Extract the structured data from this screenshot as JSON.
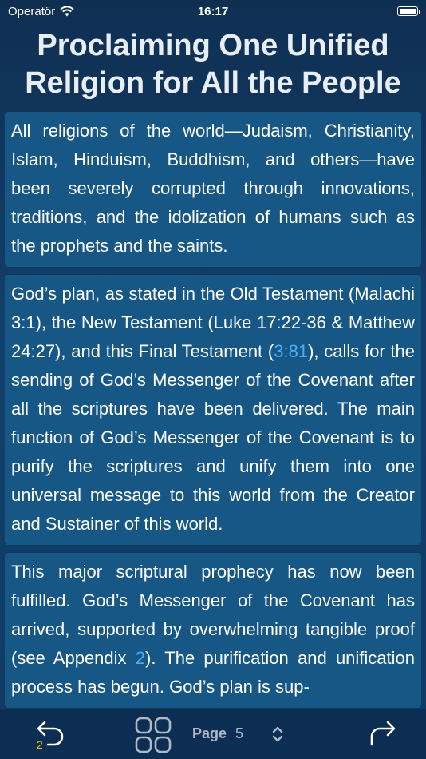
{
  "status": {
    "carrier": "Operatör",
    "time": "16:17"
  },
  "title_line1": "Proclaiming One Unified",
  "title_line2": "Religion for All the People",
  "cards": {
    "p1": "All religions of the world—Judaism, Christianity, Islam, Hinduism, Buddhism, and others—have been severely corrupted through innovations, traditions, and the idolization of humans such as the prophets and the saints.",
    "p2_before": "God’s plan, as stated in the Old Testament (Malachi 3:1), the New Testament (Luke 17:22-36 & Matthew 24:27), and this Final Testament (",
    "p2_link": "3:81",
    "p2_after": "), calls for the sending of God’s Messenger of the Covenant after all the scriptures have been delivered. The main function of God’s Messenger of the Covenant is to purify the scriptures and unify them into one universal message to this world from the Creator and Sustainer of this world.",
    "p3_before": "This major scriptural prophecy has now been fulfilled. God’s Messenger of the Covenant has arrived, supported by overwhelming tangible proof (see Appendix ",
    "p3_link": "2",
    "p3_after": "). The purification and unification process has begun. God’s plan is sup-"
  },
  "toolbar": {
    "back_count": "2",
    "page_label": "Page",
    "page_number": "5"
  },
  "colors": {
    "accent_link": "#49b0f0",
    "badge": "#f2c200",
    "card_bg": "#175786",
    "toolbar_bg": "#0c2e52"
  }
}
